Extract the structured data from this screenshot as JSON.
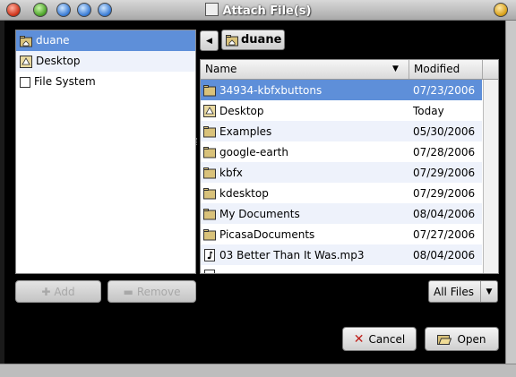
{
  "window": {
    "title": "Attach File(s)"
  },
  "sidebar": {
    "items": [
      {
        "label": "duane",
        "icon": "home-folder-icon",
        "selected": true
      },
      {
        "label": "Desktop",
        "icon": "desktop-icon",
        "selected": false
      },
      {
        "label": "File System",
        "icon": "drive-icon",
        "selected": false
      }
    ],
    "add_label": "Add",
    "remove_label": "Remove"
  },
  "pathbar": {
    "current": "duane"
  },
  "filelist": {
    "columns": [
      "Name",
      "Modified"
    ],
    "rows": [
      {
        "name": "34934-kbfxbuttons",
        "modified": "07/23/2006",
        "type": "folder",
        "selected": true
      },
      {
        "name": "Desktop",
        "modified": "Today",
        "type": "desktop",
        "selected": false
      },
      {
        "name": "Examples",
        "modified": "05/30/2006",
        "type": "folder",
        "selected": false
      },
      {
        "name": "google-earth",
        "modified": "07/28/2006",
        "type": "folder",
        "selected": false
      },
      {
        "name": "kbfx",
        "modified": "07/29/2006",
        "type": "folder",
        "selected": false
      },
      {
        "name": "kdesktop",
        "modified": "07/29/2006",
        "type": "folder",
        "selected": false
      },
      {
        "name": "My Documents",
        "modified": "08/04/2006",
        "type": "folder",
        "selected": false
      },
      {
        "name": "PicasaDocuments",
        "modified": "07/27/2006",
        "type": "folder",
        "selected": false
      },
      {
        "name": "03 Better Than It Was.mp3",
        "modified": "08/04/2006",
        "type": "audio",
        "selected": false
      }
    ]
  },
  "filter": {
    "selected": "All Files"
  },
  "actions": {
    "cancel_label": "Cancel",
    "open_label": "Open"
  },
  "colors": {
    "selection": "#5e8fd9",
    "alt_row": "#eef2fb",
    "background": "#000000"
  }
}
